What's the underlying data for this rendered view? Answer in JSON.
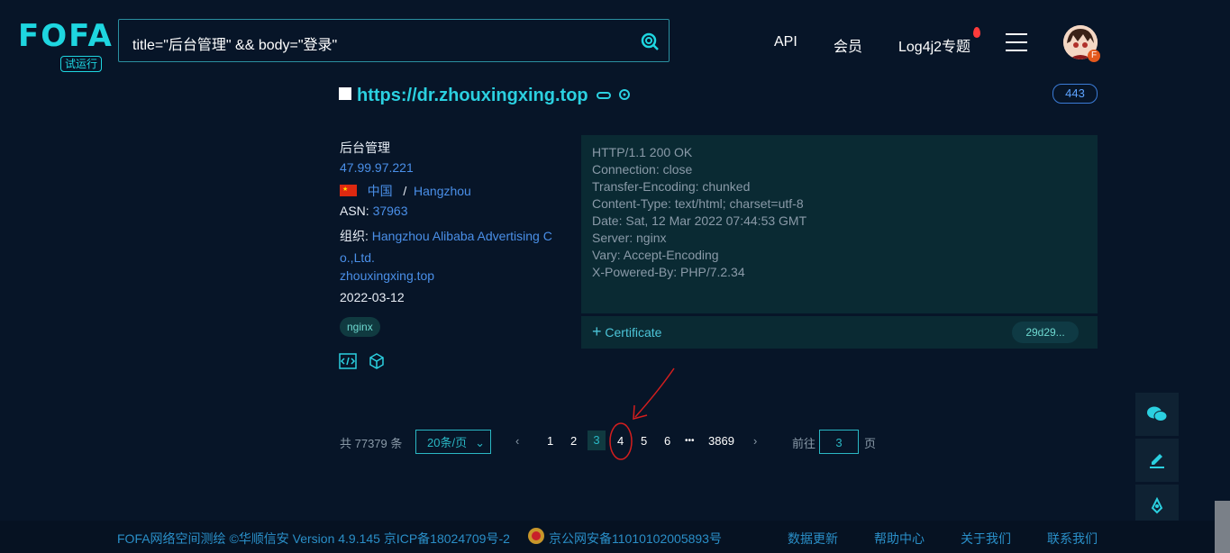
{
  "header": {
    "logo": "FOFA",
    "logo_badge": "试运行",
    "search_query": "title=\"后台管理\" && body=\"登录\"",
    "nav": [
      "API",
      "会员",
      "Log4j2专题"
    ]
  },
  "result": {
    "url": "https://dr.zhouxingxing.top",
    "port": "443",
    "title": "后台管理",
    "ip": "47.99.97.221",
    "country": "中国",
    "separator": "/",
    "city": "Hangzhou",
    "asn_label": "ASN:",
    "asn": "37963",
    "org_label": "组织:",
    "org_line1": "Hangzhou Alibaba Advertising C",
    "org_line2": "o.,Ltd.",
    "domain": "zhouxingxing.top",
    "date": "2022-03-12",
    "tag": "nginx",
    "http_headers": [
      "HTTP/1.1 200 OK",
      "Connection: close",
      "Transfer-Encoding: chunked",
      "Content-Type: text/html; charset=utf-8",
      "Date: Sat, 12 Mar 2022 07:44:53 GMT",
      "Server: nginx",
      "Vary: Accept-Encoding",
      "X-Powered-By: PHP/7.2.34"
    ],
    "certificate_label": "Certificate",
    "certificate_hash": "29d29..."
  },
  "pagination": {
    "total": "共 77379 条",
    "page_size": "20条/页",
    "pages": [
      "1",
      "2",
      "3",
      "4",
      "5",
      "6"
    ],
    "current": "3",
    "ellipsis": "•••",
    "last": "3869",
    "goto_label": "前往",
    "goto_value": "3",
    "goto_suffix": "页"
  },
  "footer": {
    "copyright": "FOFA网络空间测绘 ©华顺信安 Version 4.9.145 京ICP备18024709号-2",
    "police": "京公网安备11010102005893号",
    "links": [
      "数据更新",
      "帮助中心",
      "关于我们",
      "联系我们"
    ]
  }
}
